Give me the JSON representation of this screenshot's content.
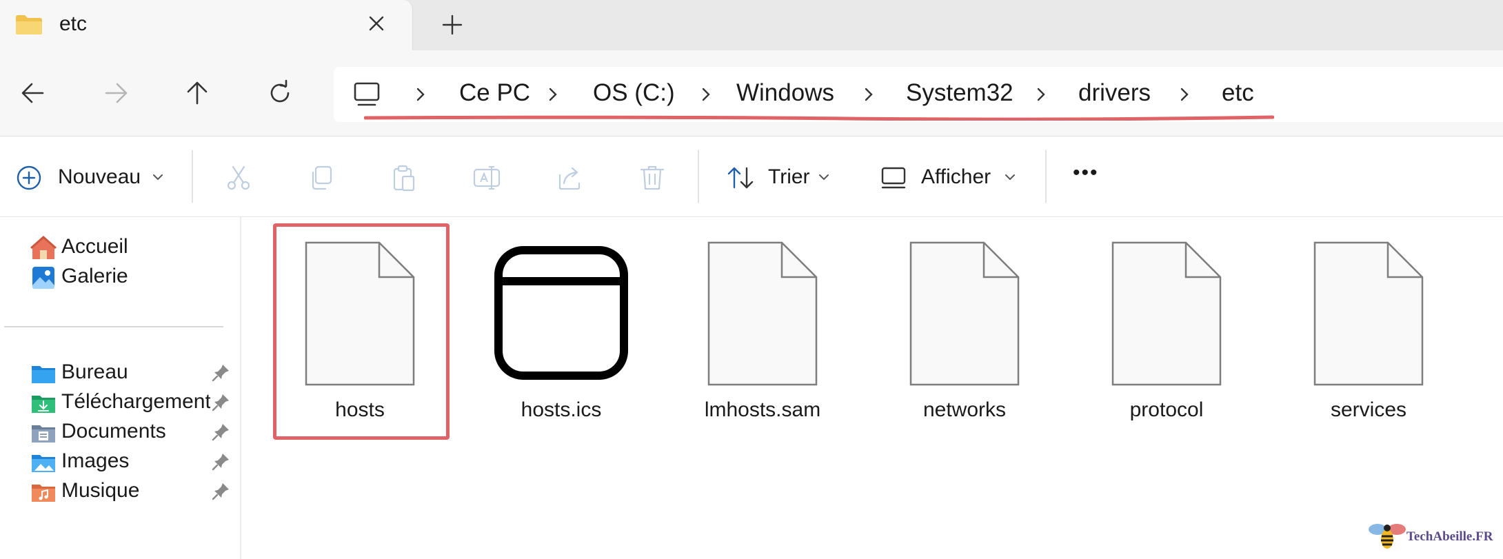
{
  "tab": {
    "title": "etc",
    "close_icon": "close-icon",
    "new_tab_icon": "plus-icon"
  },
  "nav": {
    "back_icon": "arrow-left-icon",
    "forward_icon": "arrow-right-icon",
    "up_icon": "arrow-up-icon",
    "refresh_icon": "refresh-icon"
  },
  "breadcrumb": {
    "root_icon": "computer-icon",
    "items": [
      "Ce PC",
      "OS (C:)",
      "Windows",
      "System32",
      "drivers",
      "etc"
    ],
    "highlight_color": "#e06467"
  },
  "toolbar": {
    "new_label": "Nouveau",
    "sort_label": "Trier",
    "view_label": "Afficher",
    "more_label": "•••",
    "icons": [
      "cut-icon",
      "copy-icon",
      "paste-icon",
      "rename-icon",
      "share-icon",
      "delete-icon"
    ]
  },
  "sidebar": {
    "top": [
      {
        "label": "Accueil",
        "icon": "home-icon"
      },
      {
        "label": "Galerie",
        "icon": "gallery-icon"
      }
    ],
    "pinned": [
      {
        "label": "Bureau",
        "icon": "desktop-folder-icon"
      },
      {
        "label": "Téléchargements",
        "icon": "downloads-folder-icon"
      },
      {
        "label": "Documents",
        "icon": "documents-folder-icon"
      },
      {
        "label": "Images",
        "icon": "pictures-folder-icon"
      },
      {
        "label": "Musique",
        "icon": "music-folder-icon"
      }
    ]
  },
  "files": [
    {
      "name": "hosts",
      "icon": "file-icon",
      "selected": true
    },
    {
      "name": "hosts.ics",
      "icon": "app-window-icon"
    },
    {
      "name": "lmhosts.sam",
      "icon": "file-icon"
    },
    {
      "name": "networks",
      "icon": "file-icon"
    },
    {
      "name": "protocol",
      "icon": "file-icon"
    },
    {
      "name": "services",
      "icon": "file-icon"
    }
  ],
  "watermark": {
    "text": "TechAbeille.FR"
  },
  "colors": {
    "accent": "#e06467",
    "chrome": "#f7f7f7",
    "tabbar": "#e9e9e9"
  }
}
